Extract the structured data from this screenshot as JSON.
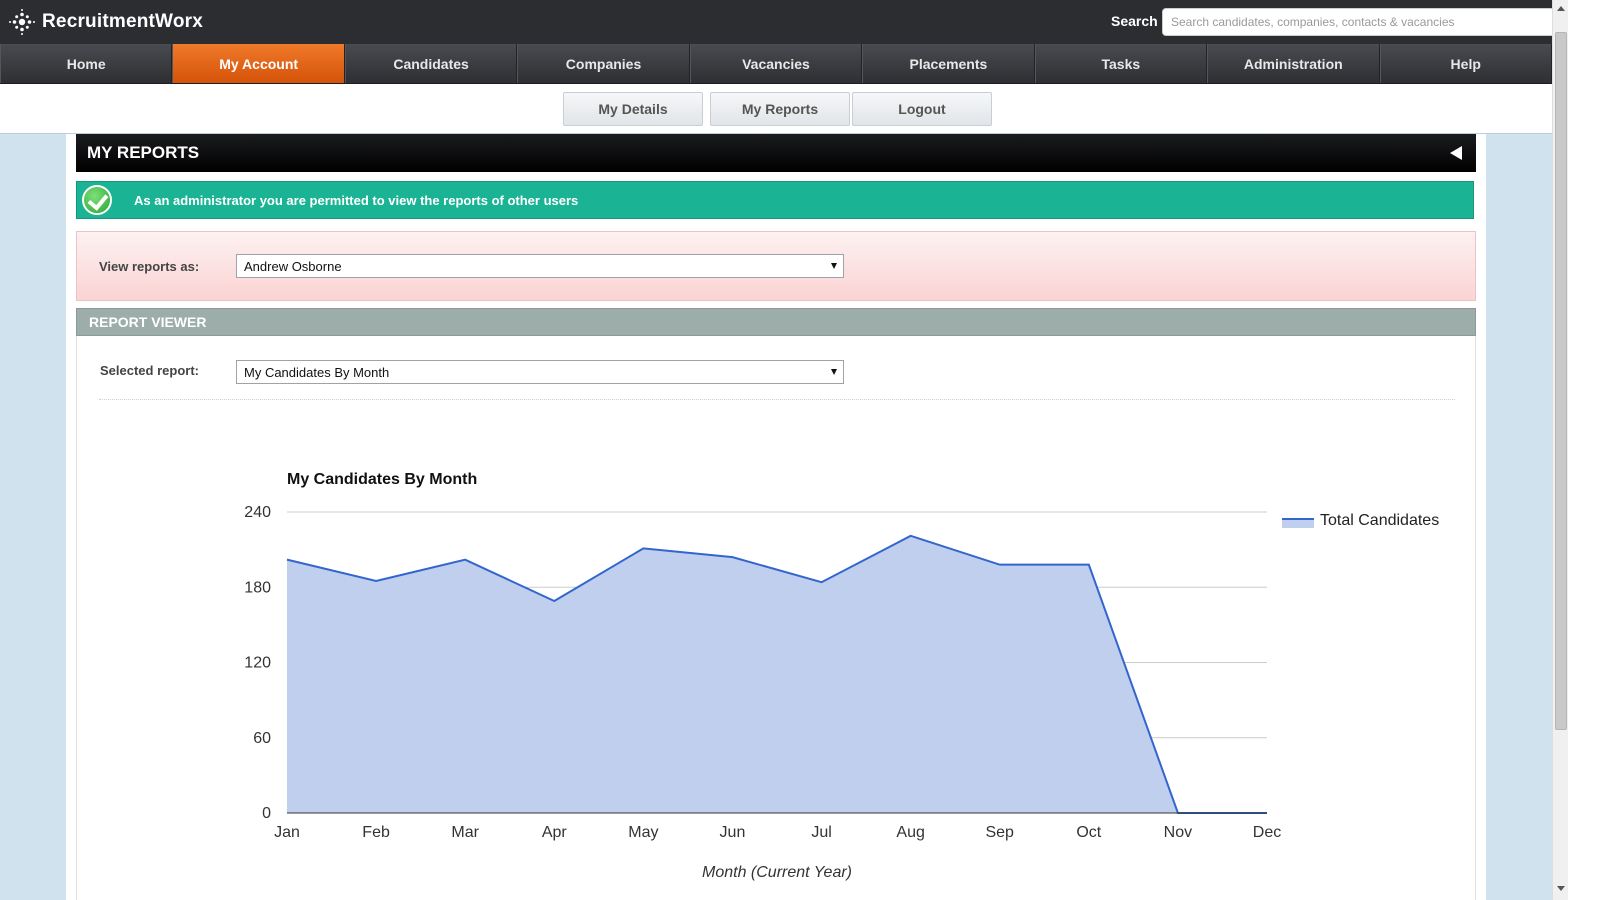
{
  "app": {
    "name": "RecruitmentWorx",
    "logo_icon": "sparkle-dots-icon"
  },
  "search": {
    "label": "Search",
    "placeholder": "Search candidates, companies, contacts & vacancies",
    "value": ""
  },
  "nav": {
    "items": [
      {
        "label": "Home",
        "active": false
      },
      {
        "label": "My Account",
        "active": true
      },
      {
        "label": "Candidates",
        "active": false
      },
      {
        "label": "Companies",
        "active": false
      },
      {
        "label": "Vacancies",
        "active": false
      },
      {
        "label": "Placements",
        "active": false
      },
      {
        "label": "Tasks",
        "active": false
      },
      {
        "label": "Administration",
        "active": false
      },
      {
        "label": "Help",
        "active": false
      }
    ],
    "active_color": "#e8680f"
  },
  "subnav": {
    "items": [
      "My Details",
      "My Reports",
      "Logout"
    ]
  },
  "section": {
    "title": "MY REPORTS",
    "collapse_icon": "triangle-left-icon"
  },
  "notice": {
    "icon": "checkmark-circle-icon",
    "text": "As an administrator you are permitted to view the reports of other users",
    "color": "#1ab394"
  },
  "view_as": {
    "label": "View reports as:",
    "selected": "Andrew Osborne"
  },
  "viewer": {
    "title": "REPORT VIEWER",
    "report_label": "Selected report:",
    "selected_report": "My Candidates By Month"
  },
  "chart_data": {
    "type": "area",
    "title": "My Candidates By Month",
    "xlabel": "Month (Current Year)",
    "ylabel": "",
    "categories": [
      "Jan",
      "Feb",
      "Mar",
      "Apr",
      "May",
      "Jun",
      "Jul",
      "Aug",
      "Sep",
      "Oct",
      "Nov",
      "Dec"
    ],
    "series": [
      {
        "name": "Total Candidates",
        "values": [
          202,
          185,
          202,
          169,
          211,
          204,
          184,
          221,
          198,
          198,
          0,
          0
        ],
        "color": "#3366cc",
        "fill": "#c0cfee"
      }
    ],
    "yticks": [
      0,
      60,
      120,
      180,
      240
    ],
    "ylim": [
      0,
      240
    ],
    "grid": true,
    "legend": "right"
  }
}
